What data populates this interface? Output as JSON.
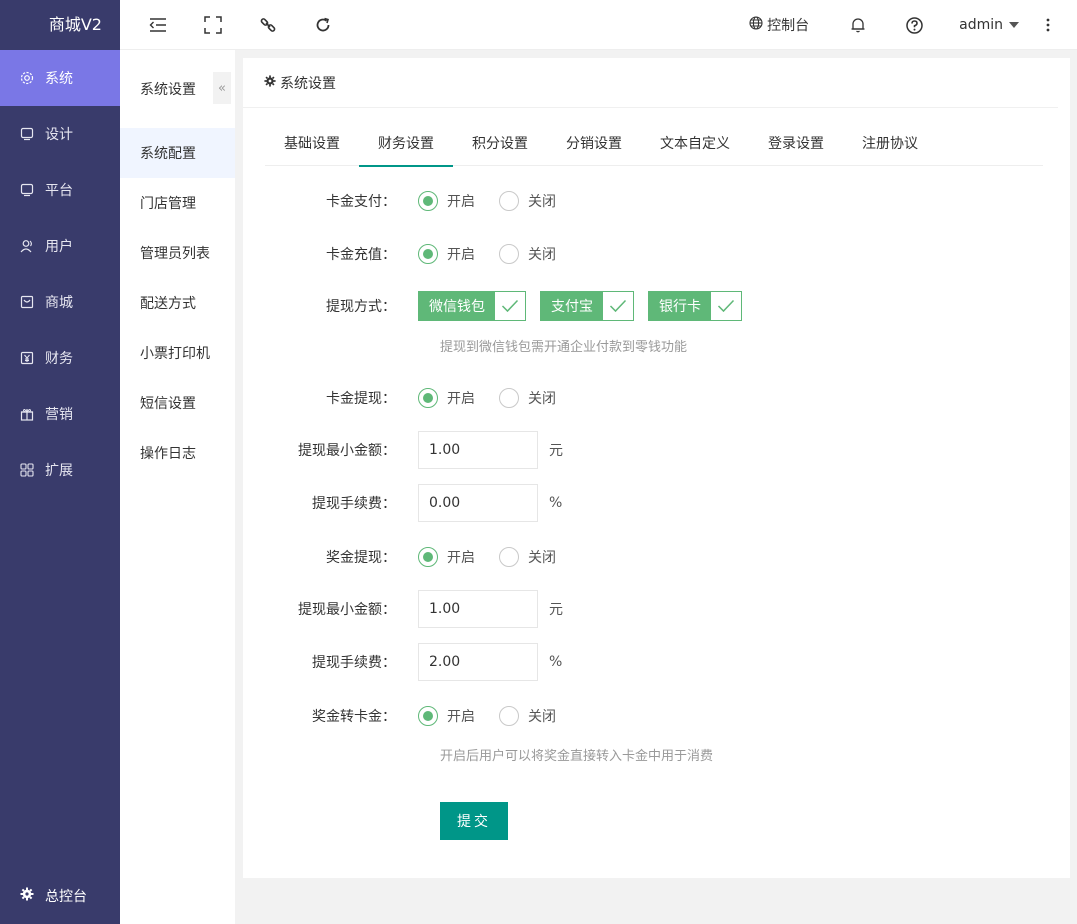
{
  "app": {
    "title": "商城V2"
  },
  "sidebar": {
    "items": [
      {
        "label": "系统",
        "icon": "gear-icon",
        "active": true
      },
      {
        "label": "设计",
        "icon": "monitor-icon",
        "active": false
      },
      {
        "label": "平台",
        "icon": "monitor-icon",
        "active": false
      },
      {
        "label": "用户",
        "icon": "users-icon",
        "active": false
      },
      {
        "label": "商城",
        "icon": "shop-icon",
        "active": false
      },
      {
        "label": "财务",
        "icon": "yen-icon",
        "active": false
      },
      {
        "label": "营销",
        "icon": "gift-icon",
        "active": false
      },
      {
        "label": "扩展",
        "icon": "grid-icon",
        "active": false
      }
    ],
    "bottom_label": "总控台"
  },
  "topbar": {
    "console_label": "控制台",
    "user_label": "admin"
  },
  "submenu": {
    "title": "系统设置",
    "collapse_glyph": "«",
    "items": [
      {
        "label": "系统配置",
        "active": true
      },
      {
        "label": "门店管理",
        "active": false
      },
      {
        "label": "管理员列表",
        "active": false
      },
      {
        "label": "配送方式",
        "active": false
      },
      {
        "label": "小票打印机",
        "active": false
      },
      {
        "label": "短信设置",
        "active": false
      },
      {
        "label": "操作日志",
        "active": false
      }
    ]
  },
  "card": {
    "title": "系统设置",
    "tabs": [
      {
        "label": "基础设置",
        "active": false
      },
      {
        "label": "财务设置",
        "active": true
      },
      {
        "label": "积分设置",
        "active": false
      },
      {
        "label": "分销设置",
        "active": false
      },
      {
        "label": "文本自定义",
        "active": false
      },
      {
        "label": "登录设置",
        "active": false
      },
      {
        "label": "注册协议",
        "active": false
      }
    ]
  },
  "form": {
    "radio_on": "开启",
    "radio_off": "关闭",
    "card_pay": {
      "label": "卡金支付：",
      "value": "on"
    },
    "card_recharge": {
      "label": "卡金充值：",
      "value": "on"
    },
    "withdraw_method": {
      "label": "提现方式：",
      "options": [
        "微信钱包",
        "支付宝",
        "银行卡"
      ],
      "hint": "提现到微信钱包需开通企业付款到零钱功能"
    },
    "card_withdraw": {
      "label": "卡金提现：",
      "value": "on"
    },
    "card_min": {
      "label": "提现最小金额：",
      "value": "1.00",
      "unit": "元"
    },
    "card_fee": {
      "label": "提现手续费：",
      "value": "0.00",
      "unit": "%"
    },
    "bonus_withdraw": {
      "label": "奖金提现：",
      "value": "on"
    },
    "bonus_min": {
      "label": "提现最小金额：",
      "value": "1.00",
      "unit": "元"
    },
    "bonus_fee": {
      "label": "提现手续费：",
      "value": "2.00",
      "unit": "%"
    },
    "bonus_to_card": {
      "label": "奖金转卡金：",
      "value": "on",
      "hint": "开启后用户可以将奖金直接转入卡金中用于消费"
    },
    "submit_label": "提交"
  },
  "colors": {
    "sidebar_bg": "#393b6b",
    "sidebar_active": "#7a77e6",
    "primary": "#009688",
    "green": "#5fb878"
  }
}
